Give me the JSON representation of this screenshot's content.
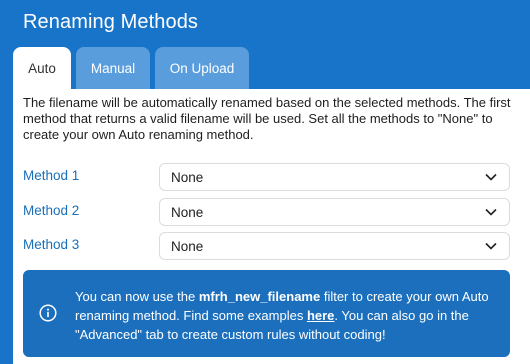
{
  "header": {
    "title": "Renaming Methods"
  },
  "tabs": [
    {
      "label": "Auto"
    },
    {
      "label": "Manual"
    },
    {
      "label": "On Upload"
    }
  ],
  "description": "The filename will be automatically renamed based on the selected methods. The first method that returns a valid filename will be used. Set all the methods to \"None\" to create your own Auto renaming method.",
  "methods": [
    {
      "label": "Method 1",
      "value": "None"
    },
    {
      "label": "Method 2",
      "value": "None"
    },
    {
      "label": "Method 3",
      "value": "None"
    }
  ],
  "notice": {
    "icon": "info-icon",
    "part1": "You can now use the ",
    "filter_name": "mfrh_new_filename",
    "part2": " filter to create your own Auto renaming method. Find some examples ",
    "link_text": "here",
    "part3": ". You can also go in the \"Advanced\" tab to create custom rules without coding!"
  }
}
